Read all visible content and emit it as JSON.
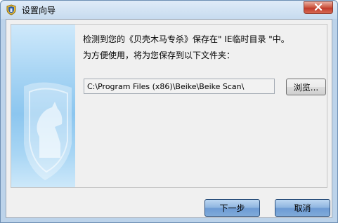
{
  "window": {
    "title": "设置向导",
    "icons": {
      "app": "shield-icon",
      "close": "close-icon",
      "banner": "knight-shield-icon"
    }
  },
  "content": {
    "message_line1": "检测到您的《贝壳木马专杀》保存在\" IE临时目录 \"中。",
    "message_line2": "为方便使用，将为您保存到以下文件夹：",
    "path_value": "C:\\Program Files (x86)\\Beike\\Beike Scan\\"
  },
  "buttons": {
    "browse": "浏览...",
    "next": "下一步",
    "cancel": "取消"
  },
  "colors": {
    "accent": "#7faad9",
    "banner": "#8cc6ef",
    "close": "#c0392b"
  }
}
